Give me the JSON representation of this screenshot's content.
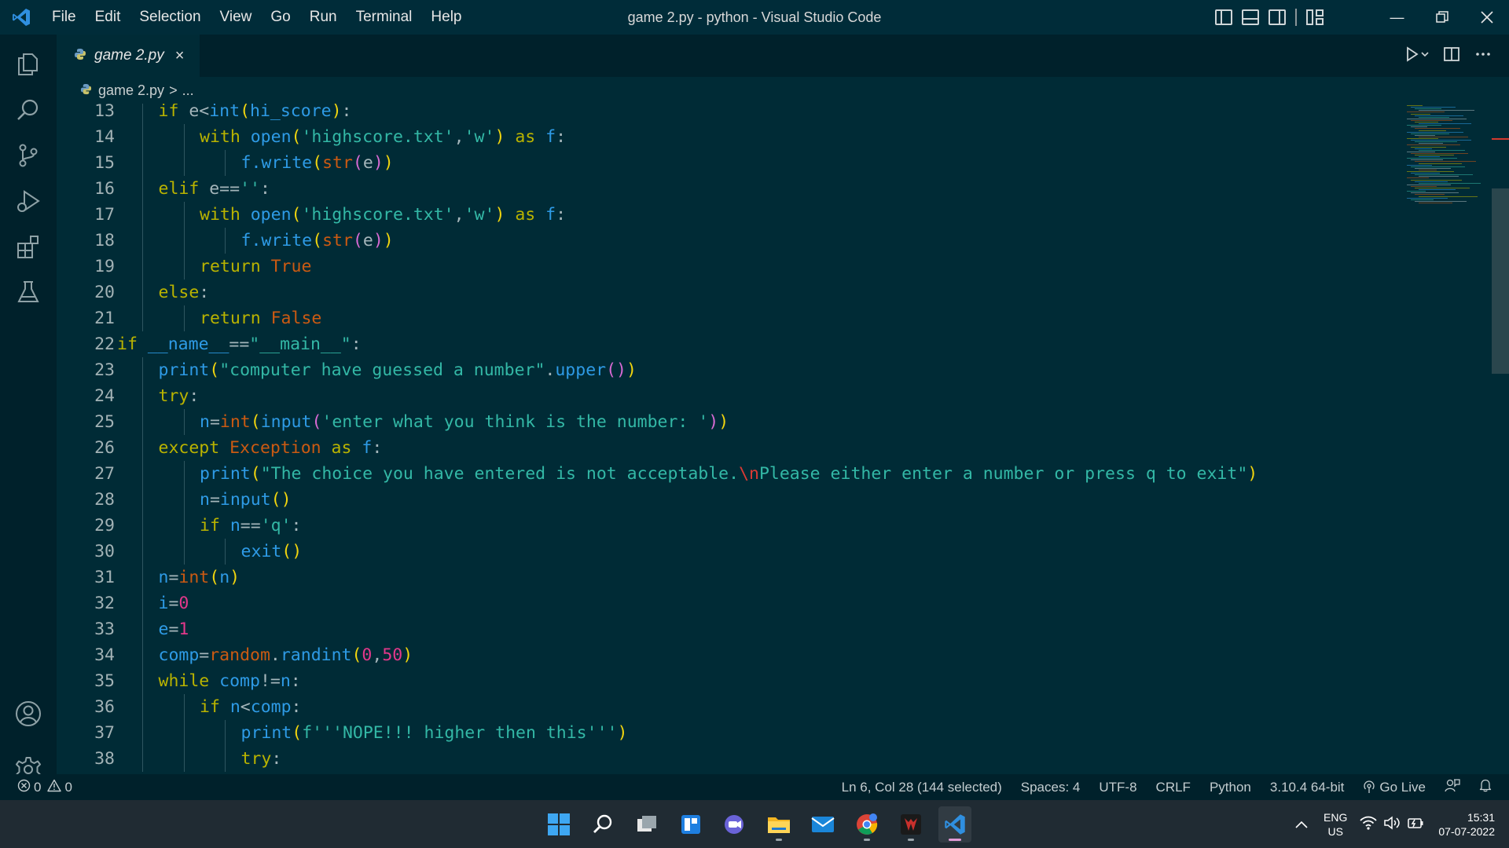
{
  "window": {
    "title": "game 2.py - python - Visual Studio Code"
  },
  "menu": [
    "File",
    "Edit",
    "Selection",
    "View",
    "Go",
    "Run",
    "Terminal",
    "Help"
  ],
  "tab": {
    "label": "game 2.py",
    "close": "×"
  },
  "breadcrumb": {
    "file": "game 2.py",
    "separator": ">",
    "more": "..."
  },
  "editor": {
    "lines": [
      {
        "n": "13",
        "i": 1,
        "t": [
          [
            "kw",
            "if "
          ],
          [
            "pl",
            "e<"
          ],
          [
            "fn",
            "int"
          ],
          [
            "par1",
            "("
          ],
          [
            "fn",
            "hi_score"
          ],
          [
            "par1",
            ")"
          ],
          [
            "pl",
            ":"
          ]
        ]
      },
      {
        "n": "14",
        "i": 2,
        "t": [
          [
            "kw",
            "with "
          ],
          [
            "fn",
            "open"
          ],
          [
            "par1",
            "("
          ],
          [
            "str",
            "'highscore.txt'"
          ],
          [
            "pl",
            ","
          ],
          [
            "str",
            "'w'"
          ],
          [
            "par1",
            ")"
          ],
          [
            "kw",
            " as "
          ],
          [
            "fn",
            "f"
          ],
          [
            "pl",
            ":"
          ]
        ]
      },
      {
        "n": "15",
        "i": 3,
        "t": [
          [
            "fn",
            "f.write"
          ],
          [
            "par1",
            "("
          ],
          [
            "cls",
            "str"
          ],
          [
            "par2",
            "("
          ],
          [
            "pl",
            "e"
          ],
          [
            "par2",
            ")"
          ],
          [
            "par1",
            ")"
          ]
        ]
      },
      {
        "n": "16",
        "i": 1,
        "t": [
          [
            "kw",
            "elif "
          ],
          [
            "pl",
            "e=="
          ],
          [
            "str",
            "''"
          ],
          [
            "pl",
            ":"
          ]
        ]
      },
      {
        "n": "17",
        "i": 2,
        "t": [
          [
            "kw",
            "with "
          ],
          [
            "fn",
            "open"
          ],
          [
            "par1",
            "("
          ],
          [
            "str",
            "'highscore.txt'"
          ],
          [
            "pl",
            ","
          ],
          [
            "str",
            "'w'"
          ],
          [
            "par1",
            ")"
          ],
          [
            "kw",
            " as "
          ],
          [
            "fn",
            "f"
          ],
          [
            "pl",
            ":"
          ]
        ]
      },
      {
        "n": "18",
        "i": 3,
        "t": [
          [
            "fn",
            "f.write"
          ],
          [
            "par1",
            "("
          ],
          [
            "cls",
            "str"
          ],
          [
            "par2",
            "("
          ],
          [
            "pl",
            "e"
          ],
          [
            "par2",
            ")"
          ],
          [
            "par1",
            ")"
          ]
        ]
      },
      {
        "n": "19",
        "i": 2,
        "t": [
          [
            "kw",
            "return "
          ],
          [
            "cls",
            "True"
          ]
        ]
      },
      {
        "n": "20",
        "i": 1,
        "t": [
          [
            "kw",
            "else"
          ],
          [
            "pl",
            ":"
          ]
        ]
      },
      {
        "n": "21",
        "i": 2,
        "t": [
          [
            "kw",
            "return "
          ],
          [
            "cls",
            "False"
          ]
        ]
      },
      {
        "n": "22",
        "i": 0,
        "t": [
          [
            "kw",
            "if "
          ],
          [
            "fn",
            "__name__"
          ],
          [
            "pl",
            "=="
          ],
          [
            "str",
            "\"__main__\""
          ],
          [
            "pl",
            ":"
          ]
        ]
      },
      {
        "n": "23",
        "i": 1,
        "t": [
          [
            "fn",
            "print"
          ],
          [
            "par1",
            "("
          ],
          [
            "str",
            "\"computer have guessed a number\""
          ],
          [
            "pl",
            "."
          ],
          [
            "fn",
            "upper"
          ],
          [
            "par2",
            "()"
          ],
          [
            "par1",
            ")"
          ]
        ]
      },
      {
        "n": "24",
        "i": 1,
        "t": [
          [
            "kw",
            "try"
          ],
          [
            "pl",
            ":"
          ]
        ]
      },
      {
        "n": "25",
        "i": 2,
        "t": [
          [
            "fn",
            "n"
          ],
          [
            "pl",
            "="
          ],
          [
            "cls",
            "int"
          ],
          [
            "par1",
            "("
          ],
          [
            "fn",
            "input"
          ],
          [
            "par2",
            "("
          ],
          [
            "str",
            "'enter what you think is the number: '"
          ],
          [
            "par2",
            ")"
          ],
          [
            "par1",
            ")"
          ]
        ]
      },
      {
        "n": "26",
        "i": 1,
        "t": [
          [
            "kw",
            "except "
          ],
          [
            "cls",
            "Exception"
          ],
          [
            "kw",
            " as "
          ],
          [
            "fn",
            "f"
          ],
          [
            "pl",
            ":"
          ]
        ]
      },
      {
        "n": "27",
        "i": 2,
        "t": [
          [
            "fn",
            "print"
          ],
          [
            "par1",
            "("
          ],
          [
            "str",
            "\"The choice you have entered is not acceptable."
          ],
          [
            "esc",
            "\\n"
          ],
          [
            "str",
            "Please either enter a number or press q to exit\""
          ],
          [
            "par1",
            ")"
          ]
        ]
      },
      {
        "n": "28",
        "i": 2,
        "t": [
          [
            "fn",
            "n"
          ],
          [
            "pl",
            "="
          ],
          [
            "fn",
            "input"
          ],
          [
            "par1",
            "()"
          ]
        ]
      },
      {
        "n": "29",
        "i": 2,
        "t": [
          [
            "kw",
            "if "
          ],
          [
            "fn",
            "n"
          ],
          [
            "pl",
            "=="
          ],
          [
            "str",
            "'q'"
          ],
          [
            "pl",
            ":"
          ]
        ]
      },
      {
        "n": "30",
        "i": 3,
        "t": [
          [
            "fn",
            "exit"
          ],
          [
            "par1",
            "()"
          ]
        ]
      },
      {
        "n": "31",
        "i": 1,
        "t": [
          [
            "fn",
            "n"
          ],
          [
            "pl",
            "="
          ],
          [
            "cls",
            "int"
          ],
          [
            "par1",
            "("
          ],
          [
            "fn",
            "n"
          ],
          [
            "par1",
            ")"
          ]
        ]
      },
      {
        "n": "32",
        "i": 1,
        "t": [
          [
            "fn",
            "i"
          ],
          [
            "pl",
            "="
          ],
          [
            "num",
            "0"
          ]
        ]
      },
      {
        "n": "33",
        "i": 1,
        "t": [
          [
            "fn",
            "e"
          ],
          [
            "pl",
            "="
          ],
          [
            "num",
            "1"
          ]
        ]
      },
      {
        "n": "34",
        "i": 1,
        "t": [
          [
            "fn",
            "comp"
          ],
          [
            "pl",
            "="
          ],
          [
            "cls",
            "random"
          ],
          [
            "pl",
            "."
          ],
          [
            "fn",
            "randint"
          ],
          [
            "par1",
            "("
          ],
          [
            "num",
            "0"
          ],
          [
            "pl",
            ","
          ],
          [
            "num",
            "50"
          ],
          [
            "par1",
            ")"
          ]
        ]
      },
      {
        "n": "35",
        "i": 1,
        "t": [
          [
            "kw",
            "while "
          ],
          [
            "fn",
            "comp"
          ],
          [
            "pl",
            "!="
          ],
          [
            "fn",
            "n"
          ],
          [
            "pl",
            ":"
          ]
        ]
      },
      {
        "n": "36",
        "i": 2,
        "t": [
          [
            "kw",
            "if "
          ],
          [
            "fn",
            "n"
          ],
          [
            "pl",
            "<"
          ],
          [
            "fn",
            "comp"
          ],
          [
            "pl",
            ":"
          ]
        ]
      },
      {
        "n": "37",
        "i": 3,
        "t": [
          [
            "fn",
            "print"
          ],
          [
            "par1",
            "("
          ],
          [
            "str",
            "f'''NOPE!!! higher then this'''"
          ],
          [
            "par1",
            ")"
          ]
        ]
      },
      {
        "n": "38",
        "i": 3,
        "t": [
          [
            "kw",
            "try"
          ],
          [
            "pl",
            ":"
          ]
        ]
      }
    ]
  },
  "status": {
    "errors": "0",
    "warnings": "0",
    "position": "Ln 6, Col 28 (144 selected)",
    "spaces": "Spaces: 4",
    "encoding": "UTF-8",
    "eol": "CRLF",
    "language": "Python",
    "interpreter": "3.10.4 64-bit",
    "golive": "Go Live"
  },
  "taskbar": {
    "lang": "ENG",
    "region": "US",
    "time": "15:31",
    "date": "07-07-2022"
  },
  "colors": {
    "editor_bg": "#002b36",
    "sidebar_bg": "#00212b",
    "keyword": "#b9b300",
    "function": "#2e9be6",
    "string": "#33b8a6",
    "number": "#e3388b",
    "class": "#cb5a12"
  }
}
